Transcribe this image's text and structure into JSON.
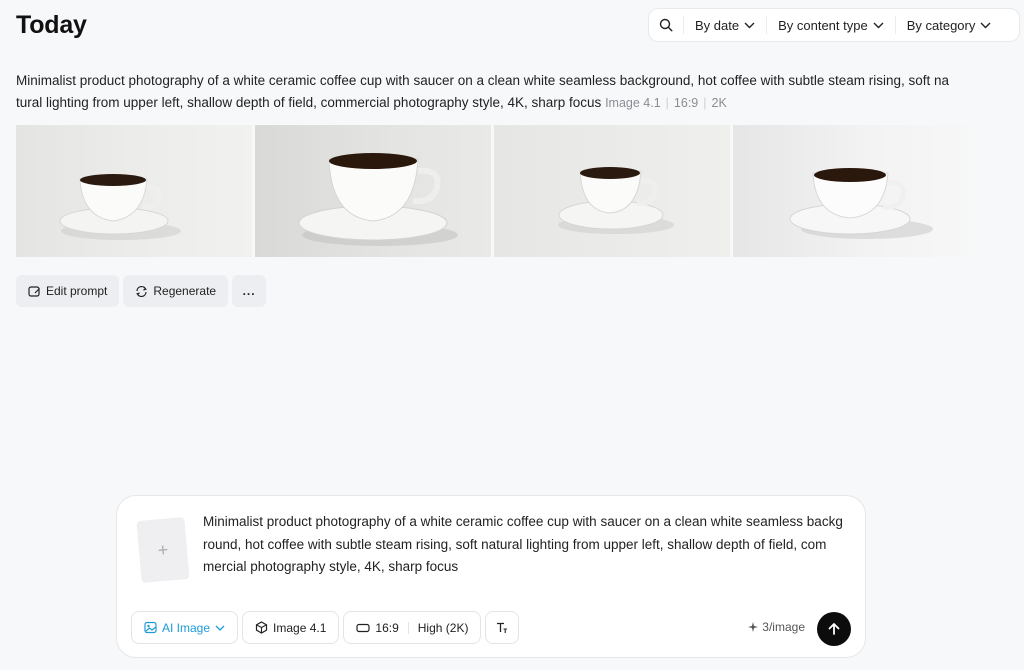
{
  "page": {
    "title": "Today"
  },
  "filters": {
    "search_icon": "search-icon",
    "by_date": "By date",
    "by_content_type": "By content type",
    "by_category": "By category"
  },
  "generation": {
    "prompt": "Minimalist product photography of a white ceramic coffee cup with saucer on a clean white seamless background, hot coffee with subtle steam rising, soft na tural lighting from upper left, shallow depth of field, commercial photography style, 4K, sharp focus",
    "model": "Image 4.1",
    "ratio": "16:9",
    "resolution": "2K",
    "images": [
      {
        "alt": "coffee cup with saucer 1"
      },
      {
        "alt": "coffee cup with saucer 2"
      },
      {
        "alt": "coffee cup with saucer 3"
      },
      {
        "alt": "coffee cup with saucer 4"
      }
    ]
  },
  "actions": {
    "edit_prompt": "Edit prompt",
    "regenerate": "Regenerate",
    "more": "..."
  },
  "composer": {
    "upload_icon": "+",
    "text": "Minimalist product photography of a white ceramic coffee cup with saucer on a clean white seamless backg round, hot coffee with subtle steam rising, soft natural lighting from upper left, shallow depth of field, com mercial photography style, 4K, sharp focus",
    "mode": "AI Image",
    "model": "Image 4.1",
    "ratio": "16:9",
    "quality": "High (2K)",
    "credits": "3/image",
    "accent_color": "#1e9bd7"
  }
}
